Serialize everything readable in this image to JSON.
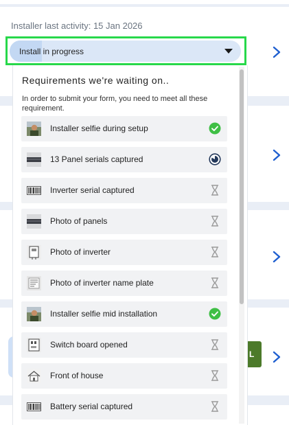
{
  "header": {
    "last_activity_label": "Installer last activity:",
    "last_activity_date": "15 Jan 2026"
  },
  "status_select": {
    "value": "Install in progress",
    "progress_fraction": 0.14
  },
  "requirements": {
    "title": "Requirements we're waiting on..",
    "description": "In order to submit your form, you need to meet all these requirement.",
    "items": [
      {
        "label": "Installer selfie during setup",
        "thumb": "selfie-photo-icon",
        "status": "complete"
      },
      {
        "label": "13 Panel serials captured",
        "thumb": "panel-photo-icon",
        "status": "partial"
      },
      {
        "label": "Inverter serial captured",
        "thumb": "barcode-icon",
        "status": "pending"
      },
      {
        "label": "Photo of panels",
        "thumb": "panel-photo-icon",
        "status": "pending"
      },
      {
        "label": "Photo of inverter",
        "thumb": "inverter-icon",
        "status": "pending"
      },
      {
        "label": "Photo of inverter name plate",
        "thumb": "name-plate-icon",
        "status": "pending"
      },
      {
        "label": "Installer selfie mid installation",
        "thumb": "selfie-photo-icon",
        "status": "complete"
      },
      {
        "label": "Switch board opened",
        "thumb": "switchboard-icon",
        "status": "pending"
      },
      {
        "label": "Front of house",
        "thumb": "house-icon",
        "status": "pending"
      },
      {
        "label": "Battery serial captured",
        "thumb": "barcode-icon",
        "status": "pending"
      }
    ]
  },
  "background": {
    "badge_text": "L"
  },
  "colors": {
    "accent_blue": "#1f5fd0",
    "highlight_green": "#27d84a",
    "check_green": "#3fbf45",
    "pending_grey": "#9a9a9a",
    "partial_navy": "#23385a"
  }
}
